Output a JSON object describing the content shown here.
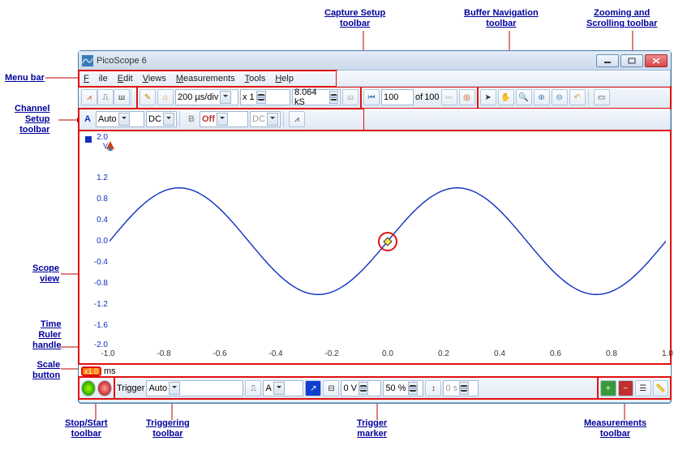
{
  "annotations": {
    "menu_bar": "Menu bar",
    "capture_setup": "Capture Setup\ntoolbar",
    "buffer_nav": "Buffer Navigation\ntoolbar",
    "zoom_scroll": "Zooming and\nScrolling toolbar",
    "channel_setup": "Channel\nSetup\ntoolbar",
    "scope_view": "Scope\nview",
    "time_ruler": "Time\nRuler\nhandle",
    "scale_button": "Scale\nbutton",
    "stop_start": "Stop/Start\ntoolbar",
    "triggering": "Triggering\ntoolbar",
    "trigger_marker": "Trigger\nmarker",
    "measurements": "Measurements\ntoolbar"
  },
  "title": "PicoScope 6",
  "menu": {
    "file": "File",
    "edit": "Edit",
    "views": "Views",
    "measurements": "Measurements",
    "tools": "Tools",
    "help": "Help"
  },
  "capture": {
    "timebase": "200 µs/div",
    "xmult": "x 1",
    "samples": "8.064 kS"
  },
  "buffer": {
    "cur": "100",
    "of": "of",
    "total": "100"
  },
  "channel": {
    "a_label": "A",
    "a_range": "Auto",
    "a_coupling": "DC",
    "b_label": "B",
    "b_range": "Off",
    "b_coupling": "DC"
  },
  "chart_data": {
    "type": "line",
    "xlabel": "ms",
    "ylabel": "V",
    "xlim": [
      -1.0,
      1.0
    ],
    "ylim": [
      -2.0,
      2.0
    ],
    "x_ticks": [
      -1.0,
      -0.8,
      -0.6,
      -0.4,
      -0.2,
      0.0,
      0.2,
      0.4,
      0.6,
      0.8,
      1.0
    ],
    "y_ticks": [
      2.0,
      1.2,
      0.8,
      0.4,
      0.0,
      -0.4,
      -0.8,
      -1.2,
      -1.6,
      -2.0
    ],
    "series": [
      {
        "name": "A",
        "amplitude_v": 1.0,
        "period_ms": 1.0,
        "phase_deg": 0,
        "offset_v": 0.0
      }
    ]
  },
  "scale": {
    "btn": "x1.0",
    "unit": "ms"
  },
  "trigger": {
    "label": "Trigger",
    "mode": "Auto",
    "source": "A",
    "level": "0 V",
    "pretrigger": "50 %",
    "delay": "0 s"
  }
}
